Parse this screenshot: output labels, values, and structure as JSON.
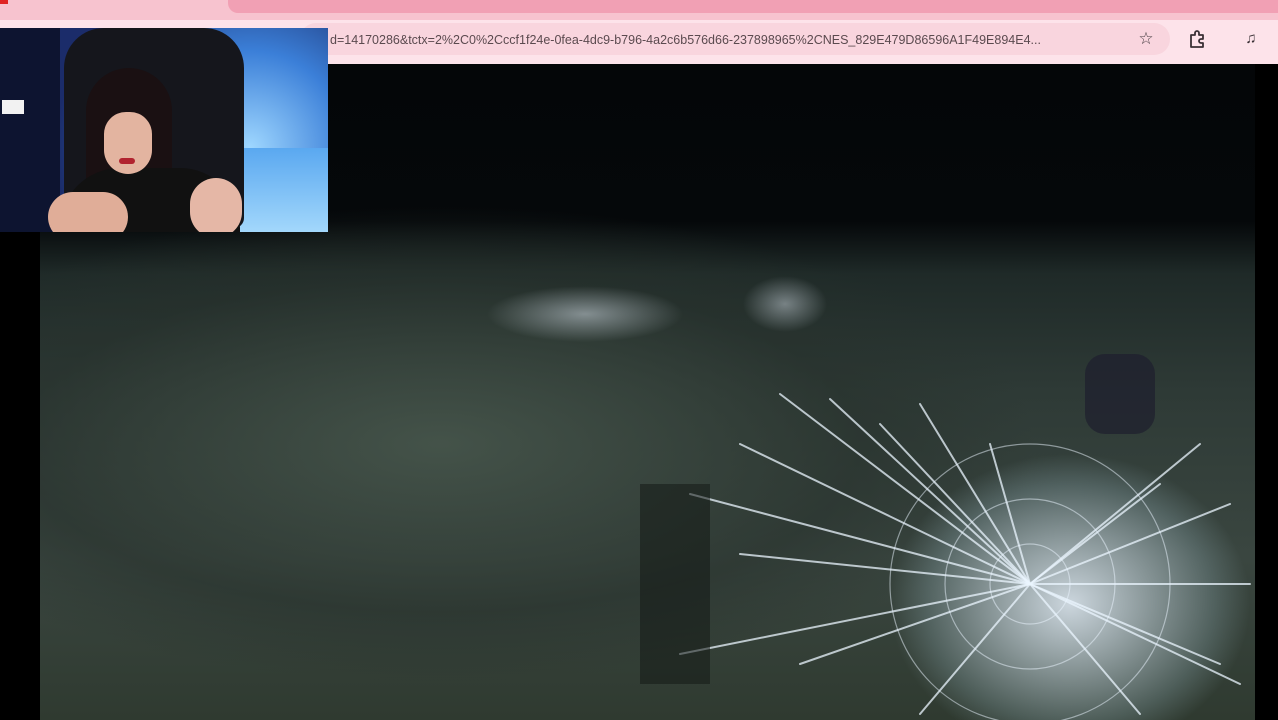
{
  "browser": {
    "url": "d=14170286&tctx=2%2C0%2Cccf1f24e-0fea-4dc9-b796-4a2c6b576d66-237898965%2CNES_829E479D86596A1F49E894E4...",
    "icons": [
      "star-icon",
      "extensions-icon",
      "media-controls-icon"
    ]
  },
  "webcam": {
    "label": "streamer-webcam"
  },
  "video": {
    "scene": "cracked-glass-night-scene"
  },
  "colors": {
    "tabstrip": "#f7c3cf",
    "toolbar": "#fde3ea",
    "omnibox": "#f9d5de",
    "brand": "#e02323"
  }
}
